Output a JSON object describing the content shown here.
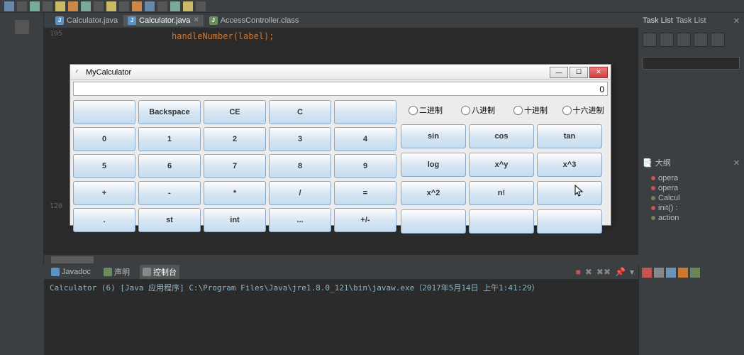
{
  "editor": {
    "tabs": [
      {
        "label": "Calculator.java",
        "active": false
      },
      {
        "label": "Calculator.java",
        "active": true
      },
      {
        "label": "AccessController.class",
        "active": false
      }
    ],
    "code_hint": "handleNumber(label);",
    "line_no_top": "105",
    "line_no_bottom": "120",
    "brace": "}"
  },
  "task_panel": {
    "title": "Task List"
  },
  "outline_panel": {
    "title": "大纲",
    "items": [
      {
        "dot": "red",
        "label": "opera"
      },
      {
        "dot": "red",
        "label": "opera"
      },
      {
        "dot": "green",
        "label": "Calcul"
      },
      {
        "dot": "red",
        "label": "init() :"
      },
      {
        "dot": "green",
        "label": "action"
      }
    ]
  },
  "bottom": {
    "tabs": [
      {
        "label": "Javadoc"
      },
      {
        "label": "声明"
      },
      {
        "label": "控制台"
      }
    ],
    "console_text": "Calculator (6) [Java 应用程序] C:\\Program Files\\Java\\jre1.8.0_121\\bin\\javaw.exe（2017年5月14日 上午1:41:29）"
  },
  "calc": {
    "title": "MyCalculator",
    "display": "0",
    "keys": [
      [
        "",
        "Backspace",
        "CE",
        "C",
        ""
      ],
      [
        "0",
        "1",
        "2",
        "3",
        "4"
      ],
      [
        "5",
        "6",
        "7",
        "8",
        "9"
      ],
      [
        "+",
        "-",
        "*",
        "/",
        "="
      ],
      [
        ".",
        "st",
        "int",
        "...",
        "+/-"
      ]
    ],
    "radios": [
      "二进制",
      "八进制",
      "十进制",
      "十六进制"
    ],
    "sci_keys": [
      [
        "sin",
        "cos",
        "tan"
      ],
      [
        "log",
        "x^y",
        "x^3"
      ],
      [
        "x^2",
        "n!",
        ""
      ],
      [
        "",
        "",
        ""
      ]
    ]
  }
}
